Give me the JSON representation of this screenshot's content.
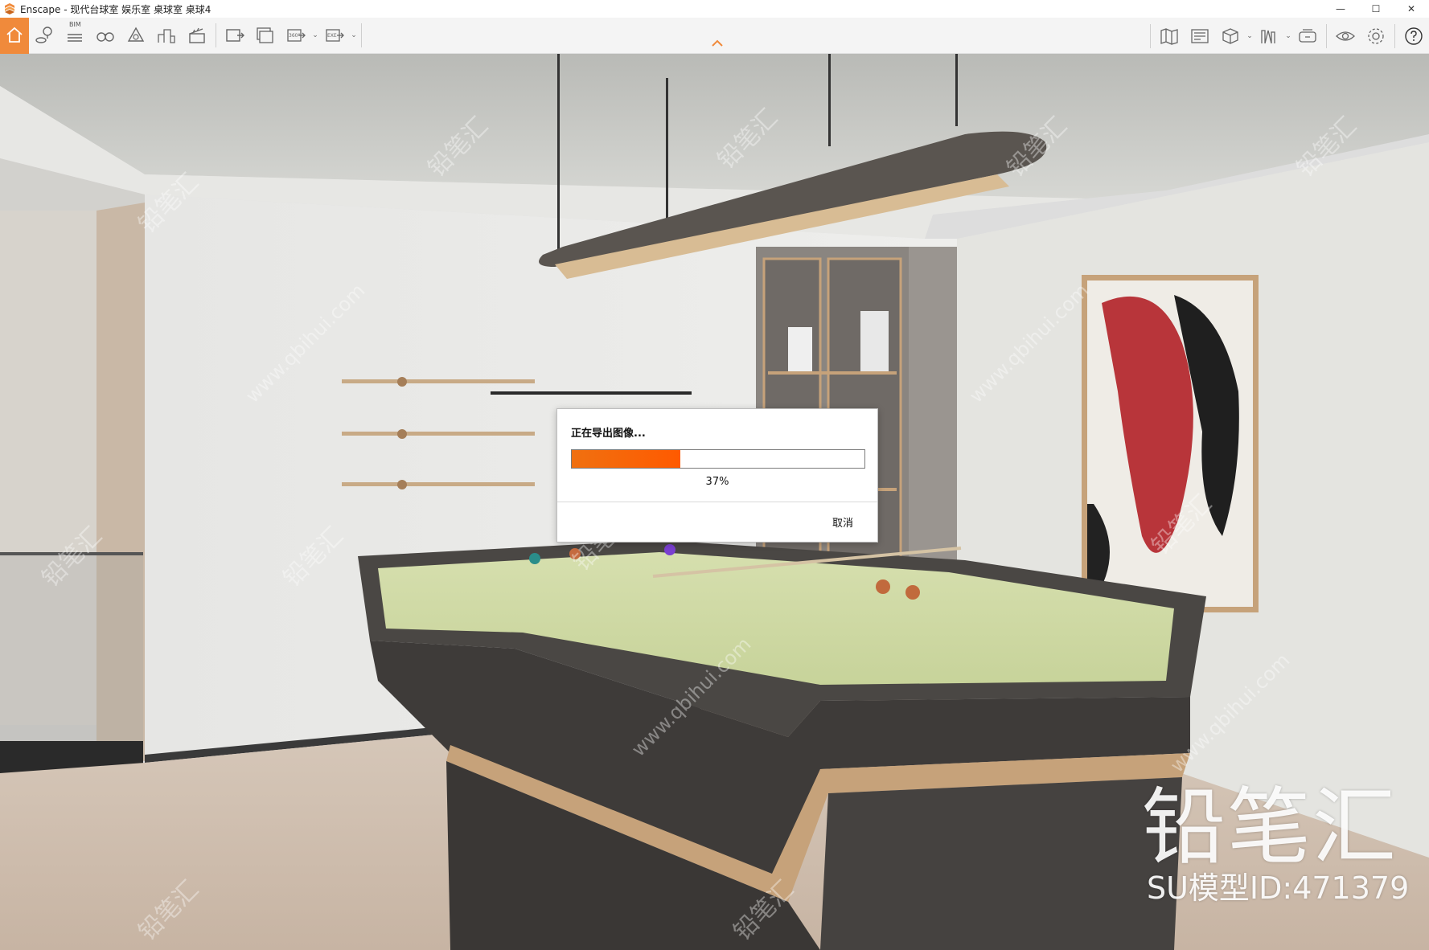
{
  "window": {
    "title": "Enscape - 现代台球室 娱乐室 桌球室 桌球4",
    "minimize_label": "—",
    "maximize_label": "☐",
    "close_label": "✕"
  },
  "toolbar": {
    "bim_label": "BIM",
    "panorama_label": "360°",
    "exe_label": "EXE",
    "accent_color": "#f08a3b",
    "left_icons": [
      "home-icon",
      "location-pin-icon",
      "bim-info-icon",
      "binoculars-icon",
      "asset-library-icon",
      "buildings-icon",
      "clapper-icon",
      "render-image-icon",
      "batch-render-icon",
      "panorama-render-icon",
      "exe-export-icon"
    ],
    "right_icons": [
      "map-icon",
      "image-view-icon",
      "cube-view-icon",
      "books-icon",
      "vr-headset-icon",
      "eye-icon",
      "settings-gear-icon",
      "help-icon"
    ]
  },
  "dialog": {
    "title": "正在导出图像...",
    "progress_text": "37%",
    "progress_fraction": 0.37,
    "cancel_label": "取消",
    "bar_color": "#ff6a00"
  },
  "watermark": {
    "brand_name": "铅笔汇",
    "model_id": "SU模型ID:471379",
    "site_text": "www.qbihui.com",
    "tile_text": "铅笔汇"
  }
}
